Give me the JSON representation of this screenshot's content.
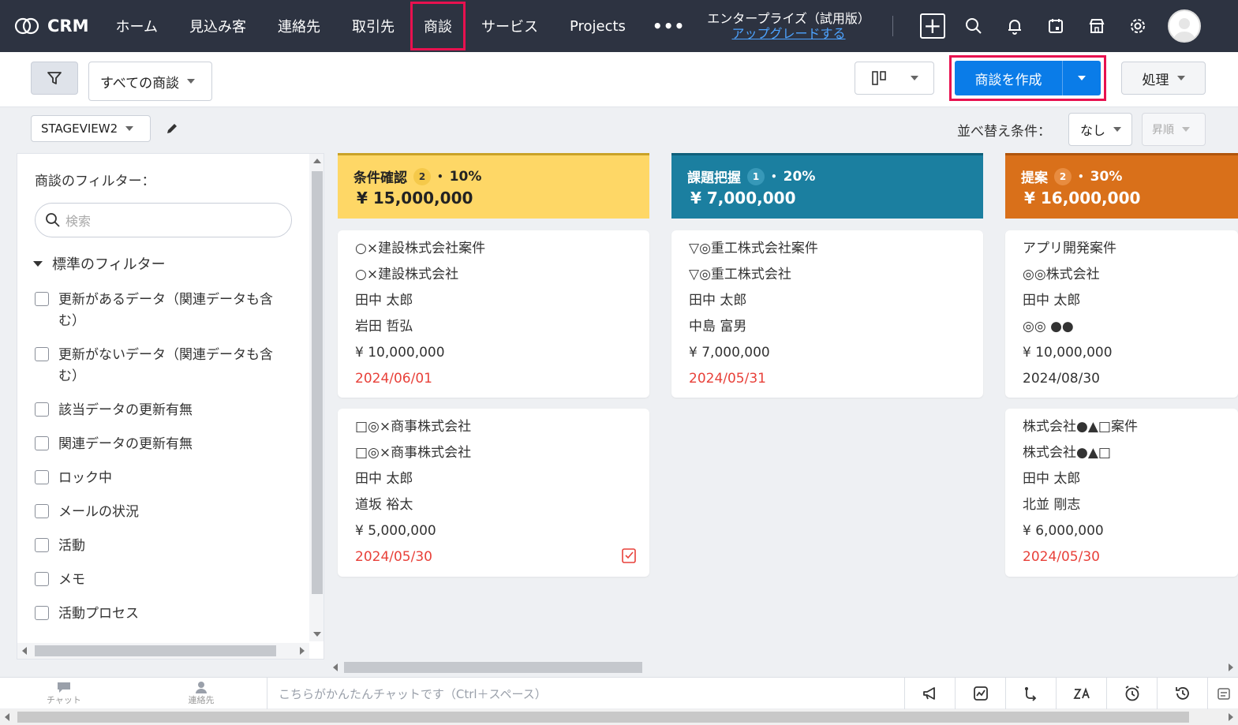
{
  "app": {
    "name": "CRM"
  },
  "nav": {
    "items": [
      "ホーム",
      "見込み客",
      "連絡先",
      "取引先",
      "商談",
      "サービス",
      "Projects"
    ],
    "active_index": 4,
    "more": "•••"
  },
  "edition": {
    "name": "エンタープライズ（試用版）",
    "upgrade": "アップグレードする"
  },
  "toolbar": {
    "view_select": "すべての商談",
    "create_button": "商談を作成",
    "action_button": "処理"
  },
  "subbar": {
    "stageview": "STAGEVIEW2",
    "sort_label": "並べ替え条件：",
    "sort_value": "なし",
    "order_value": "昇順"
  },
  "filter_panel": {
    "title": "商談のフィルター：",
    "search_placeholder": "検索",
    "section": "標準のフィルター",
    "items": [
      "更新があるデータ（関連データも含む）",
      "更新がないデータ（関連データも含む）",
      "該当データの更新有無",
      "関連データの更新有無",
      "ロック中",
      "メールの状況",
      "活動",
      "メモ",
      "活動プロセス"
    ]
  },
  "columns": [
    {
      "stage": "条件確認",
      "count": "2",
      "percent": "10%",
      "amount": "¥ 15,000,000",
      "color": "#fed766",
      "cards": [
        {
          "deal": "○×建設株式会社案件",
          "account": "○×建設株式会社",
          "owner": "田中 太郎",
          "contact": "岩田 哲弘",
          "amount": "¥ 10,000,000",
          "date": "2024/06/01"
        },
        {
          "deal": "□◎×商事株式会社",
          "account": "□◎×商事株式会社",
          "owner": "田中 太郎",
          "contact": "道坂 裕太",
          "amount": "¥ 5,000,000",
          "date": "2024/05/30"
        }
      ]
    },
    {
      "stage": "課題把握",
      "count": "1",
      "percent": "20%",
      "amount": "¥ 7,000,000",
      "color": "#1b7fa0",
      "cards": [
        {
          "deal": "▽◎重工株式会社案件",
          "account": "▽◎重工株式会社",
          "owner": "田中 太郎",
          "contact": "中島 富男",
          "amount": "¥ 7,000,000",
          "date": "2024/05/31"
        }
      ]
    },
    {
      "stage": "提案",
      "count": "2",
      "percent": "30%",
      "amount": "¥ 16,000,000",
      "color": "#d9701a",
      "cards": [
        {
          "deal": "アプリ開発案件",
          "account": "◎◎株式会社",
          "owner": "田中 太郎",
          "contact": "◎◎ ●●",
          "amount": "¥ 10,000,000",
          "date": "2024/08/30"
        },
        {
          "deal": "株式会社●▲□案件",
          "account": "株式会社●▲□",
          "owner": "田中 太郎",
          "contact": "北並 剛志",
          "amount": "¥ 6,000,000",
          "date": "2024/05/30"
        }
      ]
    }
  ],
  "bottombar": {
    "chat_tab": "チャット",
    "contacts_tab": "連絡先",
    "chat_placeholder": "こちらがかんたんチャットです（Ctrl＋スペース）"
  }
}
